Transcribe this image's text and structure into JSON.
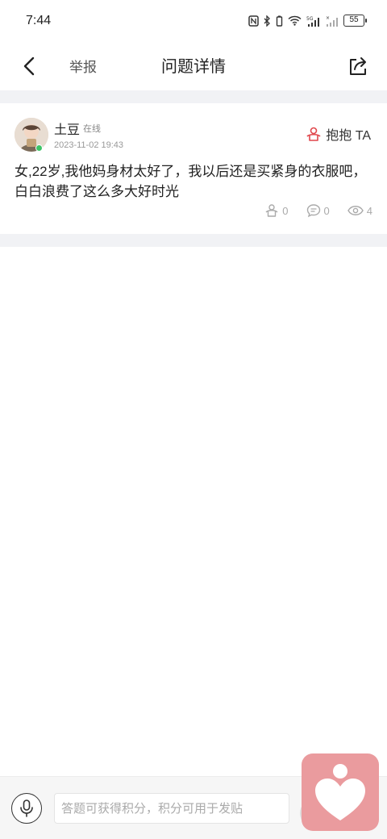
{
  "status_bar": {
    "time": "7:44",
    "battery": "55"
  },
  "nav": {
    "report_label": "举报",
    "title": "问题详情"
  },
  "post": {
    "username": "土豆",
    "online_label": "在线",
    "timestamp": "2023-11-02 19:43",
    "hug_label": "抱抱 TA",
    "content": "女,22岁,我他妈身材太好了，我以后还是买紧身的衣服吧，白白浪费了这么多大好时光",
    "stats": {
      "hugs": "0",
      "comments": "0",
      "views": "4"
    }
  },
  "bottom_bar": {
    "input_placeholder": "答题可获得积分，积分可用于发贴"
  },
  "colors": {
    "accent_red": "#e0474c",
    "float_button": "#ea9b9e",
    "band": "#f1f2f5",
    "online": "#3cc466"
  },
  "icons": {
    "back": "chevron-left-icon",
    "share": "share-icon",
    "hug": "person-hug-icon",
    "comment": "comment-icon",
    "view": "eye-icon",
    "mic": "microphone-icon",
    "heart": "heart-person-icon"
  }
}
